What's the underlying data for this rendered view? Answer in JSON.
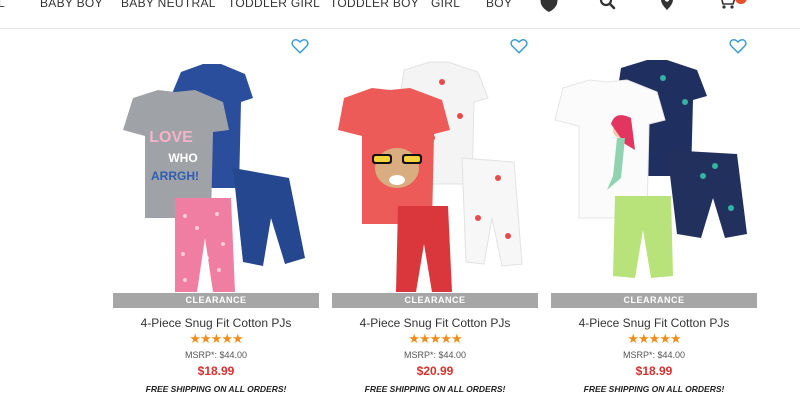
{
  "nav": {
    "items": [
      "L",
      "BABY BOY",
      "BABY NEUTRAL",
      "TODDLER GIRL",
      "TODDLER BOY",
      "GIRL",
      "BOY"
    ],
    "icons": [
      "shield-icon",
      "search-icon",
      "location-pin-icon",
      "cart-icon"
    ],
    "accent_color": "#e8502a"
  },
  "products": [
    {
      "badge": "CLEARANCE",
      "title": "4-Piece Snug Fit Cotton PJs",
      "rating": 5,
      "stars": "★★★★★",
      "msrp": "MSRP*: $44.00",
      "price": "$18.99",
      "shipping": "FREE SHIPPING ON ALL ORDERS!",
      "shirt_text": [
        "LOVE",
        "WHO",
        "ARRGH!"
      ]
    },
    {
      "badge": "CLEARANCE",
      "title": "4-Piece Snug Fit Cotton PJs",
      "rating": 5,
      "stars": "★★★★★",
      "msrp": "MSRP*: $44.00",
      "price": "$20.99",
      "shipping": "FREE SHIPPING ON ALL ORDERS!"
    },
    {
      "badge": "CLEARANCE",
      "title": "4-Piece Snug Fit Cotton PJs",
      "rating": 5,
      "stars": "★★★★★",
      "msrp": "MSRP*: $44.00",
      "price": "$18.99",
      "shipping": "FREE SHIPPING ON ALL ORDERS!"
    }
  ],
  "colors": {
    "price_red": "#d5322f",
    "star_orange": "#f08d1a",
    "heart_blue": "#3a9bd5",
    "badge_gray": "#a6a6a6"
  }
}
